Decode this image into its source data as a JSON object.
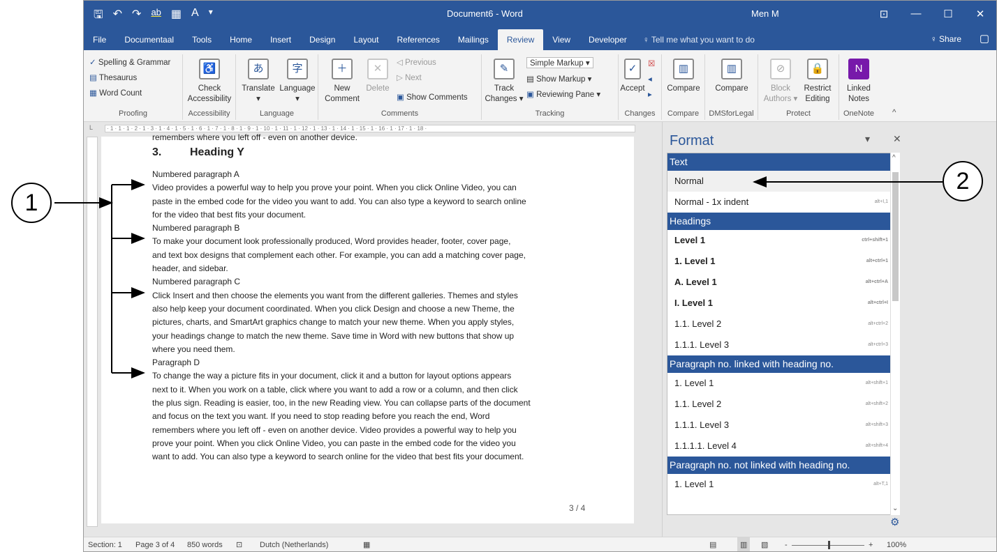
{
  "titlebar": {
    "qat_save": "🖫",
    "qat_undo": "↶",
    "qat_redo": "↷",
    "qat_highlight": "ab",
    "qat_table": "▦",
    "qat_font": "A",
    "qat_more": "▾",
    "title": "Document6 - Word",
    "user": "Men M",
    "ribbon_opt": "⊡",
    "minimize": "—",
    "maximize": "☐",
    "close": "✕"
  },
  "tabs": [
    "File",
    "Documentaal",
    "Tools",
    "Home",
    "Insert",
    "Design",
    "Layout",
    "References",
    "Mailings",
    "Review",
    "View",
    "Developer"
  ],
  "active_tab": "Review",
  "tellme": "♀ Tell me what you want to do",
  "share": "♀ Share",
  "comment_icon": "▢",
  "ribbon": {
    "proofing": {
      "spelling": "Spelling & Grammar",
      "thesaurus": "Thesaurus",
      "wordcount": "Word Count",
      "label": "Proofing"
    },
    "accessibility": {
      "check": "Check",
      "check2": "Accessibility",
      "label": "Accessibility"
    },
    "language": {
      "translate": "Translate",
      "language": "Language",
      "label": "Language",
      "dd1": "▾",
      "dd2": "▾"
    },
    "comments": {
      "new1": "New",
      "new2": "Comment",
      "delete": "Delete",
      "previous": "Previous",
      "next": "Next",
      "show": "Show Comments",
      "label": "Comments"
    },
    "tracking": {
      "track1": "Track",
      "track2": "Changes ▾",
      "markup": "Simple Markup",
      "show_markup": "Show Markup ▾",
      "reviewing": "Reviewing Pane ▾",
      "label": "Tracking"
    },
    "changes": {
      "accept": "Accept",
      "label": "Changes"
    },
    "compare": {
      "compare": "Compare",
      "label": "Compare"
    },
    "dms": {
      "compare": "Compare",
      "label": "DMSforLegal"
    },
    "protect": {
      "block1": "Block",
      "block2": "Authors ▾",
      "restrict1": "Restrict",
      "restrict2": "Editing",
      "label": "Protect"
    },
    "onenote": {
      "linked1": "Linked",
      "linked2": "Notes",
      "label": "OneNote"
    }
  },
  "ruler": "· 1 · 1 · 1 · 2 · 1 · 3 · 1 · 4 · 1 · 5 · 1 · 6 · 1 · 7 · 1 · 8 · 1 · 9 · 1 · 10 · 1 · 11 · 1 · 12 · 1 · 13 · 1 · 14 · 1 · 15 · 1 · 16 · 1 · 17 · 1 · 18 ·",
  "document": {
    "cut_line": "remembers where you left off - even on another device.",
    "heading_num": "3.",
    "heading": "Heading Y",
    "paragraphs": [
      {
        "title": "Numbered paragraph A",
        "lines": [
          "Video provides a powerful way to help you prove your point. When you click Online Video, you can",
          "paste in the embed code for the video you want to add. You can also type a keyword to search online",
          "for the video that best fits your document."
        ]
      },
      {
        "title": "Numbered paragraph B",
        "lines": [
          "To make your document look professionally produced, Word provides header, footer, cover page,",
          "and text box designs that complement each other. For example, you can add a matching cover page,",
          "header, and sidebar."
        ]
      },
      {
        "title": "Numbered paragraph C",
        "lines": [
          "Click Insert and then choose the elements you want from the different galleries. Themes and styles",
          "also help keep your document coordinated. When you click Design and choose a new Theme, the",
          "pictures, charts, and SmartArt graphics change to match your new theme. When you apply styles,",
          "your headings change to match the new theme. Save time in Word with new buttons that show up",
          "where you need them."
        ]
      },
      {
        "title": "Paragraph D",
        "lines": [
          "To change the way a picture fits in your document, click it and a button for layout options appears",
          "next to it. When you work on a table, click where you want to add a row or a column, and then click",
          "the plus sign. Reading is easier, too, in the new Reading view. You can collapse parts of the document",
          "and focus on the text you want. If you need to stop reading before you reach the end, Word",
          "remembers where you left off - even on another device. Video provides a powerful way to help you",
          "prove your point. When you click Online Video, you can paste in the embed code for the video you",
          "want to add. You can also type a keyword to search online for the video that best fits your document."
        ]
      }
    ],
    "page_number": "3 / 4"
  },
  "format_pane": {
    "title": "Format",
    "dropdown": "▾",
    "close": "✕",
    "scroll_up": "^",
    "scroll_down": "⌄",
    "gear": "⚙",
    "sections": [
      {
        "header": "Text",
        "items": [
          {
            "label": "Normal",
            "shortcut": "",
            "selected": true,
            "bold": false
          },
          {
            "label": "Normal - 1x indent",
            "shortcut": "alt+I,1",
            "bold": false
          }
        ]
      },
      {
        "header": "Headings",
        "items": [
          {
            "label": "Level 1",
            "shortcut": "ctrl+shift+1",
            "bold": true
          },
          {
            "label": "1. Level 1",
            "shortcut": "alt+ctrl+1",
            "bold": true
          },
          {
            "label": "A. Level 1",
            "shortcut": "alt+ctrl+A",
            "bold": true
          },
          {
            "label": "I. Level 1",
            "shortcut": "alt+ctrl+I",
            "bold": true
          },
          {
            "label": "1.1. Level 2",
            "shortcut": "alt+ctrl+2",
            "bold": false
          },
          {
            "label": "1.1.1. Level 3",
            "shortcut": "alt+ctrl+3",
            "bold": false
          }
        ]
      },
      {
        "header": "Paragraph no. linked with heading no.",
        "items": [
          {
            "label": "1. Level 1",
            "shortcut": "alt+shift+1",
            "bold": false
          },
          {
            "label": "1.1. Level 2",
            "shortcut": "alt+shift+2",
            "bold": false
          },
          {
            "label": "1.1.1. Level 3",
            "shortcut": "alt+shift+3",
            "bold": false
          },
          {
            "label": "1.1.1.1. Level 4",
            "shortcut": "alt+shift+4",
            "bold": false
          }
        ]
      },
      {
        "header": "Paragraph no. not linked with heading no.",
        "items": [
          {
            "label": "1. Level 1",
            "shortcut": "alt+T,1",
            "bold": false
          }
        ]
      }
    ]
  },
  "statusbar": {
    "section": "Section: 1",
    "page": "Page 3 of 4",
    "words": "850 words",
    "proof_icon": "⊡",
    "language": "Dutch (Netherlands)",
    "macro_icon": "▦",
    "view1": "▤",
    "view2": "▥",
    "view3": "▧",
    "zoom_minus": "-",
    "zoom_plus": "+",
    "zoom": "100%",
    "zoom_level": 1.0
  },
  "annotations": {
    "one": "1",
    "two": "2"
  }
}
